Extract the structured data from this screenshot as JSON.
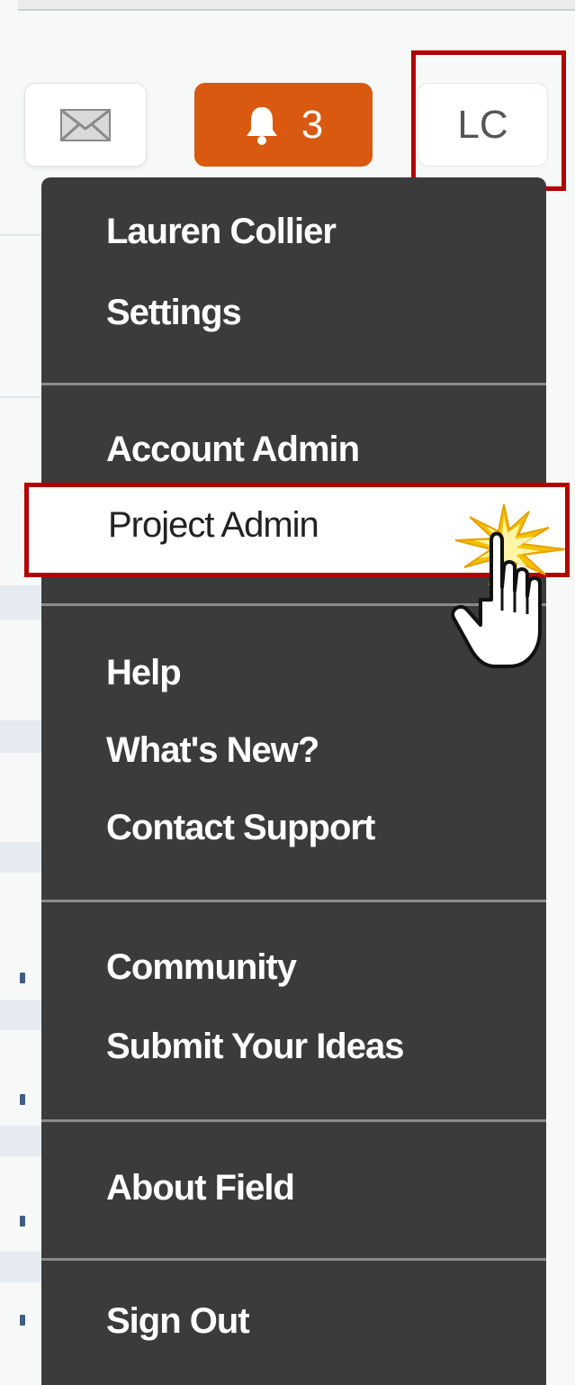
{
  "header": {
    "notification_count": "3",
    "user_initials": "LC"
  },
  "menu": {
    "user_name": "Lauren Collier",
    "settings": "Settings",
    "account_admin": "Account Admin",
    "project_admin": "Project Admin",
    "help": "Help",
    "whats_new": "What's New?",
    "contact_support": "Contact Support",
    "community": "Community",
    "submit_ideas": "Submit Your Ideas",
    "about_field": "About Field",
    "sign_out": "Sign Out"
  },
  "colors": {
    "accent_orange": "#d8590f",
    "menu_bg": "#3b3b3b",
    "highlight_red": "#b20000"
  },
  "icons": [
    "envelope-icon",
    "bell-icon",
    "hand-pointer-icon",
    "click-burst-icon"
  ]
}
